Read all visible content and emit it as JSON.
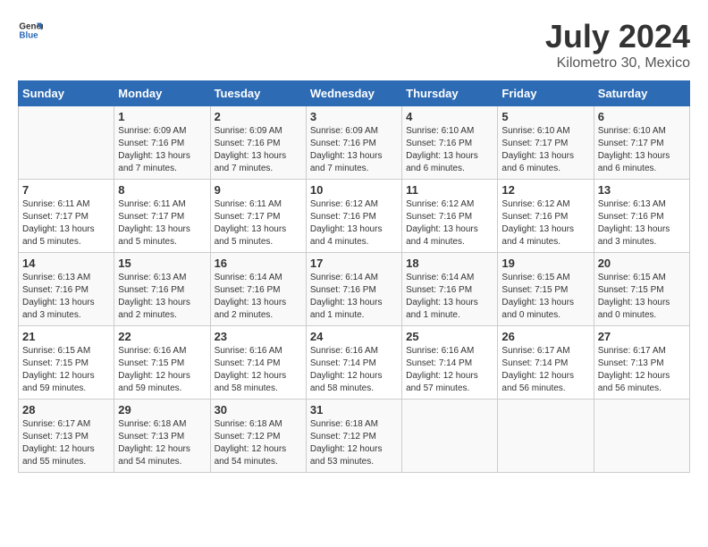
{
  "logo": {
    "line1": "General",
    "line2": "Blue"
  },
  "title": "July 2024",
  "subtitle": "Kilometro 30, Mexico",
  "days_header": [
    "Sunday",
    "Monday",
    "Tuesday",
    "Wednesday",
    "Thursday",
    "Friday",
    "Saturday"
  ],
  "weeks": [
    [
      {
        "num": "",
        "info": ""
      },
      {
        "num": "1",
        "info": "Sunrise: 6:09 AM\nSunset: 7:16 PM\nDaylight: 13 hours\nand 7 minutes."
      },
      {
        "num": "2",
        "info": "Sunrise: 6:09 AM\nSunset: 7:16 PM\nDaylight: 13 hours\nand 7 minutes."
      },
      {
        "num": "3",
        "info": "Sunrise: 6:09 AM\nSunset: 7:16 PM\nDaylight: 13 hours\nand 7 minutes."
      },
      {
        "num": "4",
        "info": "Sunrise: 6:10 AM\nSunset: 7:16 PM\nDaylight: 13 hours\nand 6 minutes."
      },
      {
        "num": "5",
        "info": "Sunrise: 6:10 AM\nSunset: 7:17 PM\nDaylight: 13 hours\nand 6 minutes."
      },
      {
        "num": "6",
        "info": "Sunrise: 6:10 AM\nSunset: 7:17 PM\nDaylight: 13 hours\nand 6 minutes."
      }
    ],
    [
      {
        "num": "7",
        "info": "Sunrise: 6:11 AM\nSunset: 7:17 PM\nDaylight: 13 hours\nand 5 minutes."
      },
      {
        "num": "8",
        "info": "Sunrise: 6:11 AM\nSunset: 7:17 PM\nDaylight: 13 hours\nand 5 minutes."
      },
      {
        "num": "9",
        "info": "Sunrise: 6:11 AM\nSunset: 7:17 PM\nDaylight: 13 hours\nand 5 minutes."
      },
      {
        "num": "10",
        "info": "Sunrise: 6:12 AM\nSunset: 7:16 PM\nDaylight: 13 hours\nand 4 minutes."
      },
      {
        "num": "11",
        "info": "Sunrise: 6:12 AM\nSunset: 7:16 PM\nDaylight: 13 hours\nand 4 minutes."
      },
      {
        "num": "12",
        "info": "Sunrise: 6:12 AM\nSunset: 7:16 PM\nDaylight: 13 hours\nand 4 minutes."
      },
      {
        "num": "13",
        "info": "Sunrise: 6:13 AM\nSunset: 7:16 PM\nDaylight: 13 hours\nand 3 minutes."
      }
    ],
    [
      {
        "num": "14",
        "info": "Sunrise: 6:13 AM\nSunset: 7:16 PM\nDaylight: 13 hours\nand 3 minutes."
      },
      {
        "num": "15",
        "info": "Sunrise: 6:13 AM\nSunset: 7:16 PM\nDaylight: 13 hours\nand 2 minutes."
      },
      {
        "num": "16",
        "info": "Sunrise: 6:14 AM\nSunset: 7:16 PM\nDaylight: 13 hours\nand 2 minutes."
      },
      {
        "num": "17",
        "info": "Sunrise: 6:14 AM\nSunset: 7:16 PM\nDaylight: 13 hours\nand 1 minute."
      },
      {
        "num": "18",
        "info": "Sunrise: 6:14 AM\nSunset: 7:16 PM\nDaylight: 13 hours\nand 1 minute."
      },
      {
        "num": "19",
        "info": "Sunrise: 6:15 AM\nSunset: 7:15 PM\nDaylight: 13 hours\nand 0 minutes."
      },
      {
        "num": "20",
        "info": "Sunrise: 6:15 AM\nSunset: 7:15 PM\nDaylight: 13 hours\nand 0 minutes."
      }
    ],
    [
      {
        "num": "21",
        "info": "Sunrise: 6:15 AM\nSunset: 7:15 PM\nDaylight: 12 hours\nand 59 minutes."
      },
      {
        "num": "22",
        "info": "Sunrise: 6:16 AM\nSunset: 7:15 PM\nDaylight: 12 hours\nand 59 minutes."
      },
      {
        "num": "23",
        "info": "Sunrise: 6:16 AM\nSunset: 7:14 PM\nDaylight: 12 hours\nand 58 minutes."
      },
      {
        "num": "24",
        "info": "Sunrise: 6:16 AM\nSunset: 7:14 PM\nDaylight: 12 hours\nand 58 minutes."
      },
      {
        "num": "25",
        "info": "Sunrise: 6:16 AM\nSunset: 7:14 PM\nDaylight: 12 hours\nand 57 minutes."
      },
      {
        "num": "26",
        "info": "Sunrise: 6:17 AM\nSunset: 7:14 PM\nDaylight: 12 hours\nand 56 minutes."
      },
      {
        "num": "27",
        "info": "Sunrise: 6:17 AM\nSunset: 7:13 PM\nDaylight: 12 hours\nand 56 minutes."
      }
    ],
    [
      {
        "num": "28",
        "info": "Sunrise: 6:17 AM\nSunset: 7:13 PM\nDaylight: 12 hours\nand 55 minutes."
      },
      {
        "num": "29",
        "info": "Sunrise: 6:18 AM\nSunset: 7:13 PM\nDaylight: 12 hours\nand 54 minutes."
      },
      {
        "num": "30",
        "info": "Sunrise: 6:18 AM\nSunset: 7:12 PM\nDaylight: 12 hours\nand 54 minutes."
      },
      {
        "num": "31",
        "info": "Sunrise: 6:18 AM\nSunset: 7:12 PM\nDaylight: 12 hours\nand 53 minutes."
      },
      {
        "num": "",
        "info": ""
      },
      {
        "num": "",
        "info": ""
      },
      {
        "num": "",
        "info": ""
      }
    ]
  ]
}
